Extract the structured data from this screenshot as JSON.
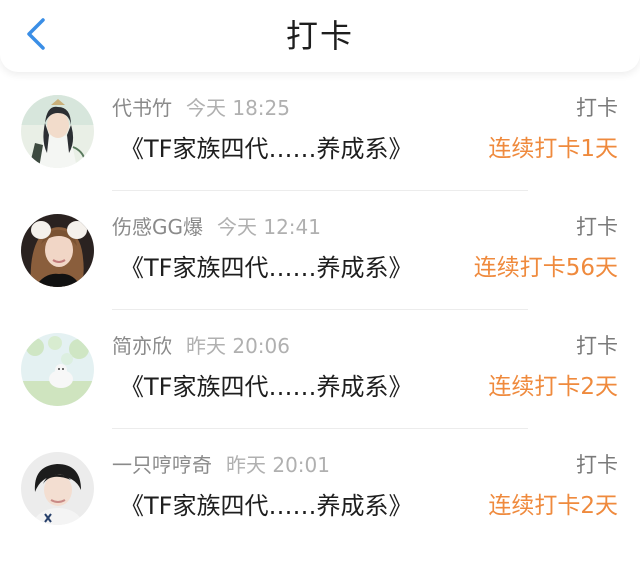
{
  "header": {
    "title": "打卡"
  },
  "entries": [
    {
      "username": "代书竹",
      "time": "今天 18:25",
      "book": "《TF家族四代……养成系》",
      "action": "打卡",
      "streak": "连续打卡1天"
    },
    {
      "username": "伤感GG爆",
      "time": "今天 12:41",
      "book": "《TF家族四代……养成系》",
      "action": "打卡",
      "streak": "连续打卡56天"
    },
    {
      "username": "简亦欣",
      "time": "昨天 20:06",
      "book": "《TF家族四代……养成系》",
      "action": "打卡",
      "streak": "连续打卡2天"
    },
    {
      "username": "一只哼哼奇",
      "time": "昨天 20:01",
      "book": "《TF家族四代……养成系》",
      "action": "打卡",
      "streak": "连续打卡2天"
    }
  ],
  "colors": {
    "accent": "#ef8a3d",
    "back_icon": "#3a8ee6"
  },
  "icons": {
    "back": "chevron-left-icon"
  }
}
